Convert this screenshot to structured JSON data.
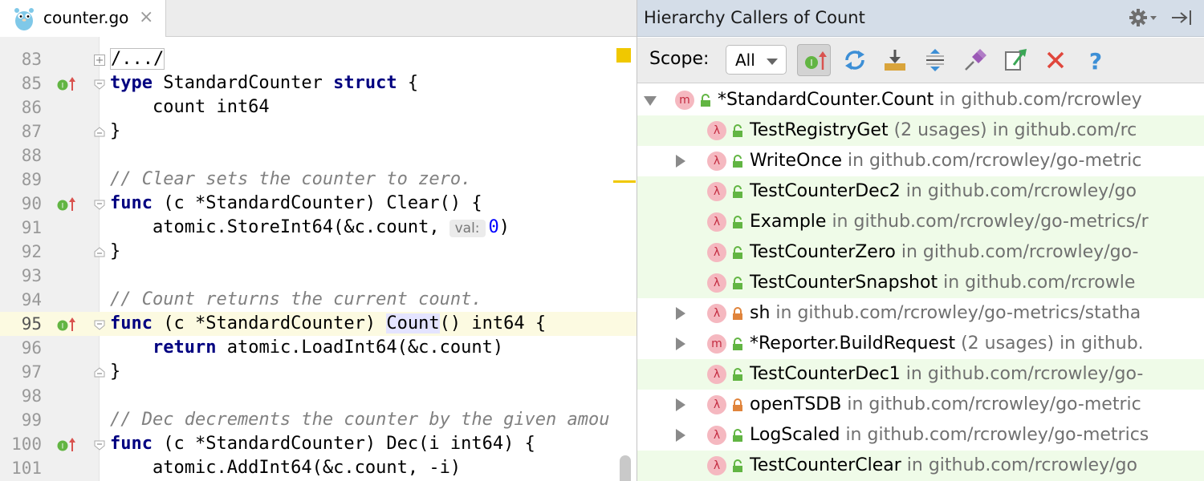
{
  "editor": {
    "tab": {
      "title": "counter.go",
      "close": "×"
    },
    "lines": [
      {
        "n": "83"
      },
      {
        "n": "85"
      },
      {
        "n": "86"
      },
      {
        "n": "87"
      },
      {
        "n": "88"
      },
      {
        "n": "89"
      },
      {
        "n": "90"
      },
      {
        "n": "91"
      },
      {
        "n": "92"
      },
      {
        "n": "93"
      },
      {
        "n": "94"
      },
      {
        "n": "95"
      },
      {
        "n": "96"
      },
      {
        "n": "97"
      },
      {
        "n": "98"
      },
      {
        "n": "99"
      },
      {
        "n": "100"
      },
      {
        "n": "101"
      }
    ],
    "code": {
      "l83": "/.../",
      "l85_kw1": "type",
      "l85_mid": " StandardCounter ",
      "l85_kw2": "struct",
      "l85_end": " {",
      "l86": "    count int64",
      "l87": "}",
      "l89": "// Clear sets the counter to zero.",
      "l90_kw": "func",
      "l90_rest": " (c *StandardCounter) Clear() {",
      "l91_pre": "    atomic.StoreInt64(&c.count,",
      "l91_hint": "val:",
      "l91_num": "0",
      "l91_end": ")",
      "l92": "}",
      "l94": "// Count returns the current count.",
      "l95_kw": "func",
      "l95_pre": " (c *StandardCounter) ",
      "l95_hl": "Count",
      "l95_end": "() int64 {",
      "l96_indent": "    ",
      "l96_kw": "return",
      "l96_rest": " atomic.LoadInt64(&c.count)",
      "l97": "}",
      "l99": "// Dec decrements the counter by the given amou",
      "l100_kw": "func",
      "l100_rest": " (c *StandardCounter) Dec(i int64) {",
      "l101": "    atomic.AddInt64(&c.count, -i)"
    }
  },
  "panel": {
    "title": "Hierarchy Callers of Count",
    "scope_label": "Scope:",
    "scope_value": "All",
    "toolbar": [
      "implementations-icon",
      "refresh-icon",
      "export-icon",
      "expand-all-icon",
      "pin-icon",
      "jump-to-source-icon",
      "close-icon",
      "help-icon"
    ],
    "items": [
      {
        "name": "*StandardCounter.Count",
        "usages": "",
        "loc": " in github.com/rcrowley",
        "kind": "m",
        "arrow": "down",
        "vis": "unlocked"
      },
      {
        "name": "TestRegistryGet",
        "usages": " (2 usages)",
        "loc": " in github.com/rc",
        "kind": "λ",
        "arrow": "",
        "vis": "unlocked"
      },
      {
        "name": "WriteOnce",
        "usages": "",
        "loc": " in github.com/rcrowley/go-metric",
        "kind": "λ",
        "arrow": "right",
        "vis": "unlocked"
      },
      {
        "name": "TestCounterDec2",
        "usages": "",
        "loc": " in github.com/rcrowley/go",
        "kind": "λ",
        "arrow": "",
        "vis": "unlocked"
      },
      {
        "name": "Example",
        "usages": "",
        "loc": " in github.com/rcrowley/go-metrics/r",
        "kind": "λ",
        "arrow": "",
        "vis": "unlocked"
      },
      {
        "name": "TestCounterZero",
        "usages": "",
        "loc": " in github.com/rcrowley/go-",
        "kind": "λ",
        "arrow": "",
        "vis": "unlocked"
      },
      {
        "name": "TestCounterSnapshot",
        "usages": "",
        "loc": " in github.com/rcrowle",
        "kind": "λ",
        "arrow": "",
        "vis": "unlocked"
      },
      {
        "name": "sh",
        "usages": "",
        "loc": " in github.com/rcrowley/go-metrics/statha",
        "kind": "λ",
        "arrow": "right",
        "vis": "locked"
      },
      {
        "name": "*Reporter.BuildRequest",
        "usages": " (2 usages)",
        "loc": " in github.",
        "kind": "m",
        "arrow": "right",
        "vis": "unlocked"
      },
      {
        "name": "TestCounterDec1",
        "usages": "",
        "loc": " in github.com/rcrowley/go-",
        "kind": "λ",
        "arrow": "",
        "vis": "unlocked"
      },
      {
        "name": "openTSDB",
        "usages": "",
        "loc": " in github.com/rcrowley/go-metric",
        "kind": "λ",
        "arrow": "right",
        "vis": "locked"
      },
      {
        "name": "LogScaled",
        "usages": "",
        "loc": " in github.com/rcrowley/go-metrics",
        "kind": "λ",
        "arrow": "right",
        "vis": "unlocked"
      },
      {
        "name": "TestCounterClear",
        "usages": "",
        "loc": " in github.com/rcrowley/go",
        "kind": "λ",
        "arrow": "",
        "vis": "unlocked"
      }
    ]
  },
  "colors": {
    "accent": "#d4dde8",
    "row_highlight": "#effbe8",
    "keyword": "#000080",
    "comment": "#808080",
    "marker": "#f0c800"
  }
}
